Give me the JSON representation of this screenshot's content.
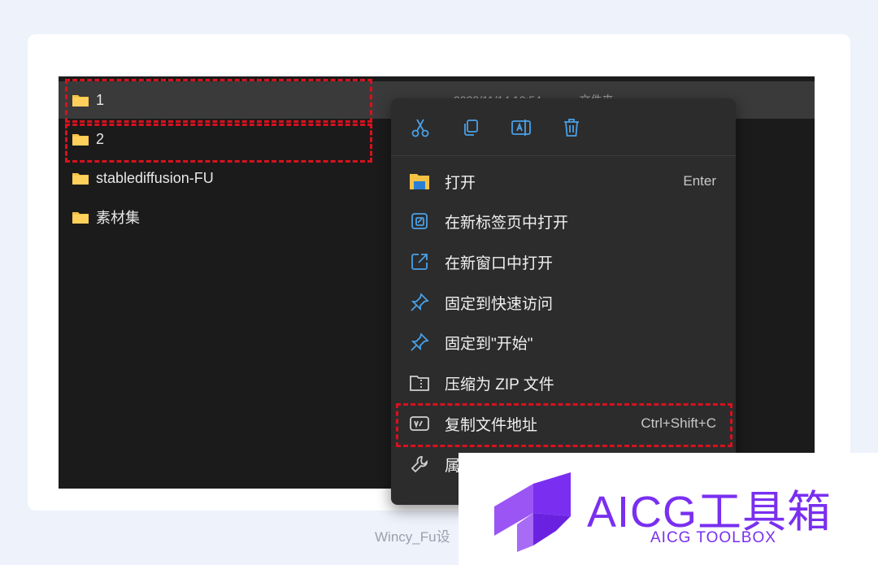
{
  "explorer": {
    "rows": [
      {
        "name": "1",
        "meta": "2023/11/14 10:54            文件夹"
      },
      {
        "name": "2",
        "meta": ""
      },
      {
        "name": "stablediffusion-FU",
        "meta": ""
      },
      {
        "name": "素材集",
        "meta": ""
      }
    ]
  },
  "context_menu": {
    "toolbar": [
      {
        "icon": "cut-icon"
      },
      {
        "icon": "copy-icon"
      },
      {
        "icon": "rename-icon"
      },
      {
        "icon": "delete-icon"
      }
    ],
    "items": [
      {
        "label": "打开",
        "shortcut": "Enter",
        "icon": "folder-open-icon"
      },
      {
        "label": "在新标签页中打开",
        "shortcut": "",
        "icon": "new-tab-icon"
      },
      {
        "label": "在新窗口中打开",
        "shortcut": "",
        "icon": "new-window-icon"
      },
      {
        "label": "固定到快速访问",
        "shortcut": "",
        "icon": "pin-icon"
      },
      {
        "label": "固定到\"开始\"",
        "shortcut": "",
        "icon": "pin-icon"
      },
      {
        "label": "压缩为 ZIP 文件",
        "shortcut": "",
        "icon": "zip-icon"
      },
      {
        "label": "复制文件地址",
        "shortcut": "Ctrl+Shift+C",
        "icon": "copy-path-icon"
      },
      {
        "label": "属",
        "shortcut": "",
        "icon": "wrench-icon"
      }
    ]
  },
  "caption": "Wincy_Fu设",
  "brand": {
    "title": "AICG工具箱",
    "subtitle": "AICG TOOLBOX",
    "color": "#7a2ff0"
  },
  "colors": {
    "highlight": "#d7121e",
    "folder": "#f6c245",
    "accent_blue": "#4aa0e6"
  }
}
